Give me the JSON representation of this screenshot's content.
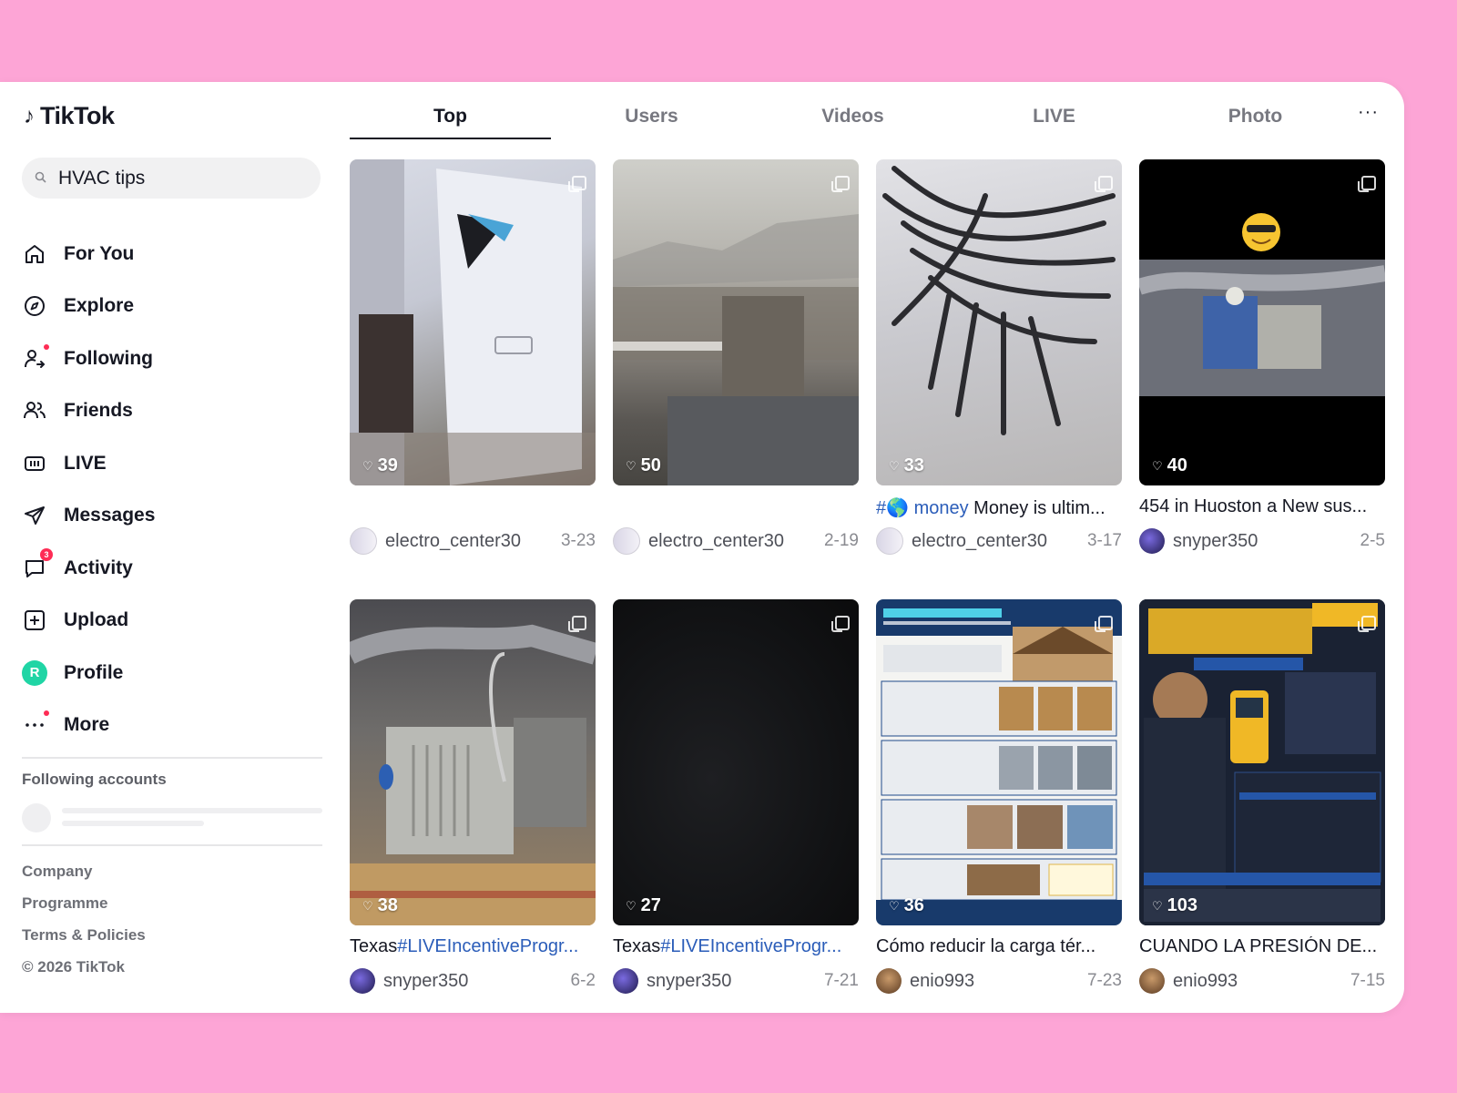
{
  "app": {
    "logo_text": "TikTok"
  },
  "search": {
    "value": "HVAC tips"
  },
  "nav": [
    {
      "label": "For You",
      "icon": "home-icon"
    },
    {
      "label": "Explore",
      "icon": "compass-icon"
    },
    {
      "label": "Following",
      "icon": "following-icon"
    },
    {
      "label": "Friends",
      "icon": "friends-icon"
    },
    {
      "label": "LIVE",
      "icon": "live-icon"
    },
    {
      "label": "Messages",
      "icon": "send-icon"
    },
    {
      "label": "Activity",
      "icon": "chat-icon",
      "badge": "3"
    },
    {
      "label": "Upload",
      "icon": "plus-square-icon"
    },
    {
      "label": "Profile",
      "icon": "profile-avatar",
      "avatar_letter": "R"
    },
    {
      "label": "More",
      "icon": "more-dots-icon"
    }
  ],
  "following": {
    "title": "Following accounts"
  },
  "footer": [
    "Company",
    "Programme",
    "Terms & Policies",
    "© 2026 TikTok"
  ],
  "tabs": [
    "Top",
    "Users",
    "Videos",
    "LIVE",
    "Photo"
  ],
  "tabs_more": "···",
  "results": [
    {
      "likes": "39",
      "caption_tag": "",
      "caption_text": "",
      "user": "electro_center30",
      "date": "3-23"
    },
    {
      "likes": "50",
      "caption_tag": "",
      "caption_text": "",
      "user": "electro_center30",
      "date": "2-19"
    },
    {
      "likes": "33",
      "caption_tag": "#🌎 money",
      "caption_text": " Money is ultim...",
      "user": "electro_center30",
      "date": "3-17"
    },
    {
      "likes": "40",
      "caption_tag": "",
      "caption_text": "454 in Huoston a New sus...",
      "user": "snyper350",
      "date": "2-5"
    },
    {
      "likes": "38",
      "caption_pre": "Texas",
      "caption_tag": "#LIVEIncentiveProgr...",
      "caption_text": "",
      "user": "snyper350",
      "date": "6-2"
    },
    {
      "likes": "27",
      "caption_pre": "Texas",
      "caption_tag": "#LIVEIncentiveProgr...",
      "caption_text": "",
      "user": "snyper350",
      "date": "7-21"
    },
    {
      "likes": "36",
      "caption_tag": "",
      "caption_text": "Cómo reducir la carga tér...",
      "user": "enio993",
      "date": "7-23"
    },
    {
      "likes": "103",
      "caption_tag": "",
      "caption_text": "CUANDO LA PRESIÓN DE...",
      "user": "enio993",
      "date": "7-15"
    }
  ]
}
